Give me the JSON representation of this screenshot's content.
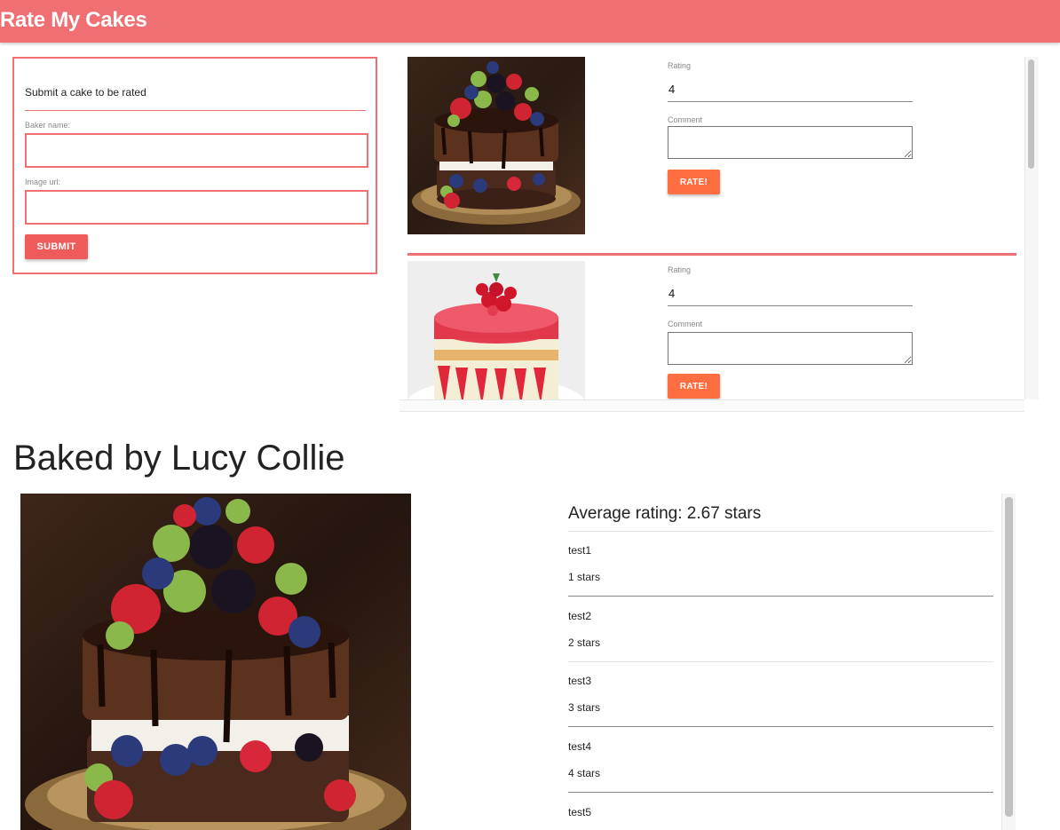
{
  "app": {
    "title": "Rate My Cakes"
  },
  "submit_form": {
    "title": "Submit a cake to be rated",
    "baker_label": "Baker name:",
    "baker_value": "",
    "image_label": "Image url:",
    "image_value": "",
    "submit_label": "SUBMIT"
  },
  "cakes": [
    {
      "image": "chocolate-berry-layer-cake",
      "rating_label": "Rating",
      "rating_value": "4",
      "comment_label": "Comment",
      "comment_value": "",
      "rate_label": "RATE!"
    },
    {
      "image": "strawberry-mousse-cake",
      "rating_label": "Rating",
      "rating_value": "4",
      "comment_label": "Comment",
      "comment_value": "",
      "rate_label": "RATE!"
    }
  ],
  "detail": {
    "heading": "Baked by Lucy Collie",
    "image": "chocolate-berry-layer-cake",
    "average": "Average rating: 2.67 stars",
    "reviews": [
      {
        "name": "test1",
        "stars": "1 stars"
      },
      {
        "name": "test2",
        "stars": "2 stars"
      },
      {
        "name": "test3",
        "stars": "3 stars"
      },
      {
        "name": "test4",
        "stars": "4 stars"
      },
      {
        "name": "test5",
        "stars": ""
      }
    ]
  },
  "colors": {
    "brand": "#ef6f72",
    "submit_button": "#ef5b5b",
    "rate_button": "#ff6e40"
  }
}
